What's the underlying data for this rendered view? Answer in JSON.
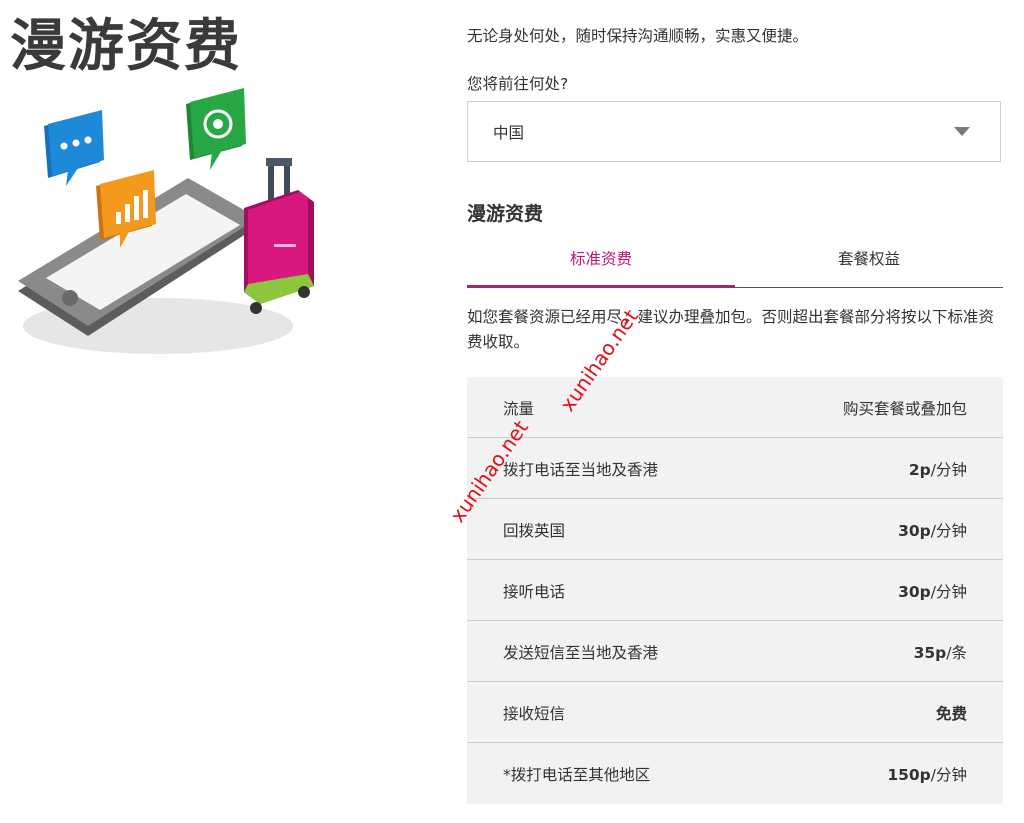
{
  "page_title": "漫游资费",
  "intro": "无论身处何处，随时保持沟通顺畅，实惠又便捷。",
  "destination": {
    "label": "您将前往何处?",
    "selected": "中国"
  },
  "section_title": "漫游资费",
  "tabs": [
    {
      "label": "标准资费",
      "active": true
    },
    {
      "label": "套餐权益",
      "active": false
    }
  ],
  "notice": "如您套餐资源已经用尽，建议办理叠加包。否则超出套餐部分将按以下标准资费收取。",
  "rates": [
    {
      "label": "流量",
      "amount": "",
      "unit": "购买套餐或叠加包"
    },
    {
      "label": "拨打电话至当地及香港",
      "amount": "2p",
      "unit": "/分钟"
    },
    {
      "label": "回拨英国",
      "amount": "30p",
      "unit": "/分钟"
    },
    {
      "label": "接听电话",
      "amount": "30p",
      "unit": "/分钟"
    },
    {
      "label": "发送短信至当地及香港",
      "amount": "35p",
      "unit": "/条"
    },
    {
      "label": "接收短信",
      "amount": "免费",
      "unit": ""
    },
    {
      "label": "*拨打电话至其他地区",
      "amount": "150p",
      "unit": "/分钟"
    }
  ],
  "watermarks": [
    "xunihao.net",
    "xunihao.net"
  ],
  "colors": {
    "accent": "#c4137a",
    "chat_blue": "#1e88d9",
    "chart_orange": "#f39a1e",
    "phone_green": "#27a844",
    "suitcase_pink": "#d8187e",
    "suitcase_green": "#8cc63f",
    "table_bg": "#f2f2f2"
  }
}
